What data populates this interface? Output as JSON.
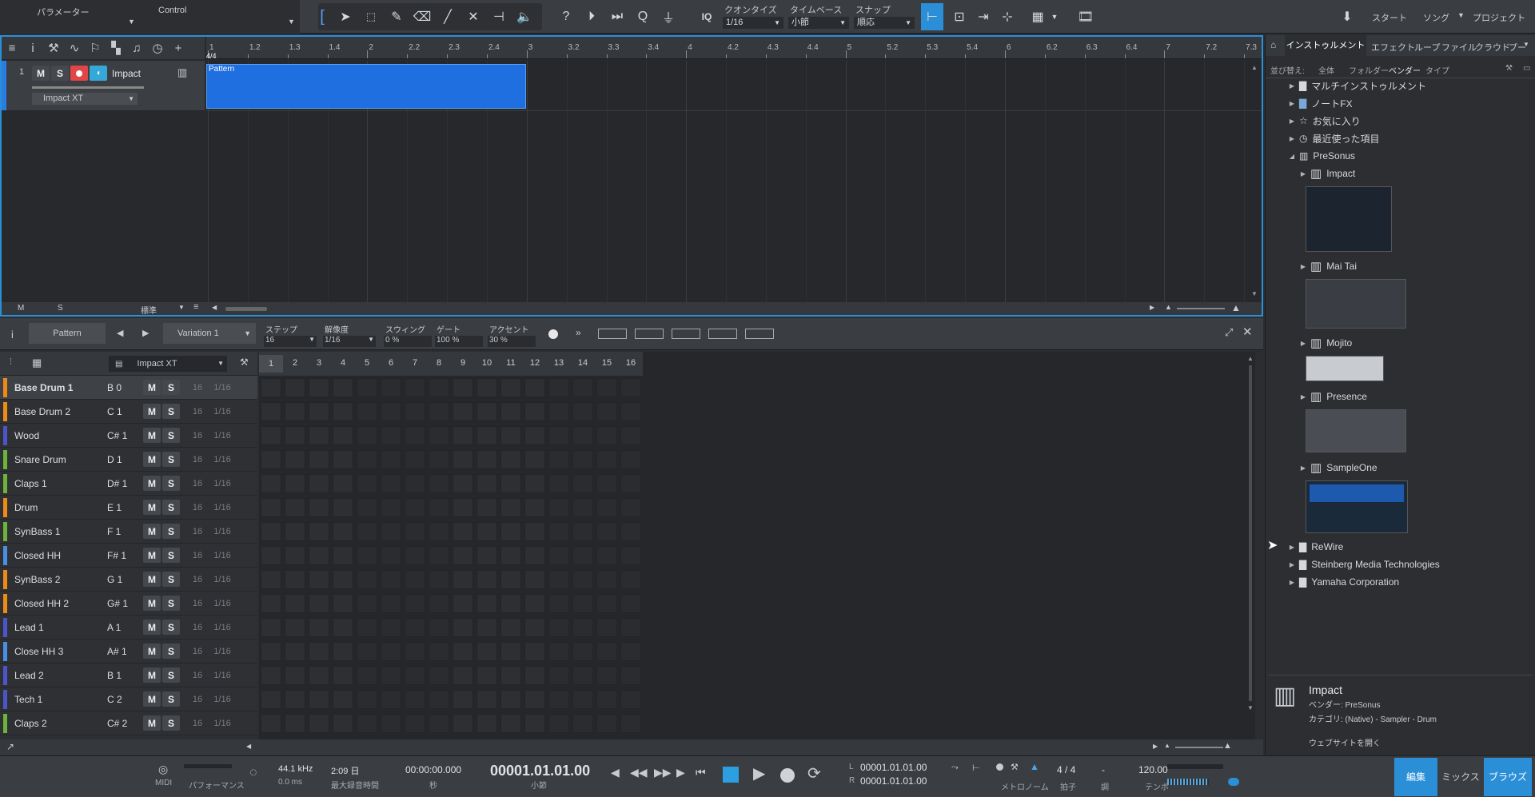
{
  "topbar": {
    "params_label": "パラメーター",
    "control_label": "Control",
    "iq": "IQ",
    "quantize": {
      "label": "クオンタイズ",
      "value": "1/16"
    },
    "timebase": {
      "label": "タイムベース",
      "value": "小節"
    },
    "snap": {
      "label": "スナップ",
      "value": "順応"
    },
    "nav": [
      "スタート",
      "ソング",
      "プロジェクト"
    ]
  },
  "arrange": {
    "ruler_marks": [
      "1",
      "1.2",
      "1.3",
      "1.4",
      "2",
      "2.2",
      "2.3",
      "2.4",
      "3",
      "3.2",
      "3.3",
      "3.4",
      "4",
      "4.2",
      "4.3",
      "4.4",
      "5",
      "5.2",
      "5.3",
      "5.4",
      "6",
      "6.2",
      "6.3",
      "6.4",
      "7",
      "7.2",
      "7.3"
    ],
    "timesig": "4/4",
    "track": {
      "number": "1",
      "m": "M",
      "s": "S",
      "name": "Impact",
      "instrument": "Impact XT"
    },
    "clip_label": "Pattern",
    "bottom": {
      "m": "M",
      "s": "S",
      "mode": "標準"
    }
  },
  "pattern_editor": {
    "pattern_label": "Pattern",
    "variation": "Variation 1",
    "step": {
      "label": "ステップ",
      "value": "16"
    },
    "resolution": {
      "label": "解像度",
      "value": "1/16"
    },
    "swing": {
      "label": "スウィング",
      "value": "0 %"
    },
    "gate": {
      "label": "ゲート",
      "value": "100 %"
    },
    "accent": {
      "label": "アクセント",
      "value": "30 %"
    },
    "instrument_select": "Impact XT",
    "step_numbers": [
      "1",
      "2",
      "3",
      "4",
      "5",
      "6",
      "7",
      "8",
      "9",
      "10",
      "11",
      "12",
      "13",
      "14",
      "15",
      "16"
    ],
    "rows": [
      {
        "name": "Base Drum 1",
        "note": "B 0",
        "color": "#f08a16",
        "steps": "16",
        "res": "1/16"
      },
      {
        "name": "Base Drum 2",
        "note": "C 1",
        "color": "#f08a16",
        "steps": "16",
        "res": "1/16"
      },
      {
        "name": "Wood",
        "note": "C# 1",
        "color": "#4a56c8",
        "steps": "16",
        "res": "1/16"
      },
      {
        "name": "Snare Drum",
        "note": "D 1",
        "color": "#6ab43a",
        "steps": "16",
        "res": "1/16"
      },
      {
        "name": "Claps 1",
        "note": "D# 1",
        "color": "#6ab43a",
        "steps": "16",
        "res": "1/16"
      },
      {
        "name": "Drum",
        "note": "E 1",
        "color": "#f08a16",
        "steps": "16",
        "res": "1/16"
      },
      {
        "name": "SynBass 1",
        "note": "F 1",
        "color": "#6ab43a",
        "steps": "16",
        "res": "1/16"
      },
      {
        "name": "Closed HH",
        "note": "F# 1",
        "color": "#4a90e2",
        "steps": "16",
        "res": "1/16"
      },
      {
        "name": "SynBass 2",
        "note": "G 1",
        "color": "#f08a16",
        "steps": "16",
        "res": "1/16"
      },
      {
        "name": "Closed HH 2",
        "note": "G# 1",
        "color": "#f08a16",
        "steps": "16",
        "res": "1/16"
      },
      {
        "name": "Lead 1",
        "note": "A 1",
        "color": "#4a56c8",
        "steps": "16",
        "res": "1/16"
      },
      {
        "name": "Close HH 3",
        "note": "A# 1",
        "color": "#4a90e2",
        "steps": "16",
        "res": "1/16"
      },
      {
        "name": "Lead 2",
        "note": "B 1",
        "color": "#4a56c8",
        "steps": "16",
        "res": "1/16"
      },
      {
        "name": "Tech 1",
        "note": "C 2",
        "color": "#4a56c8",
        "steps": "16",
        "res": "1/16"
      },
      {
        "name": "Claps 2",
        "note": "C# 2",
        "color": "#6ab43a",
        "steps": "16",
        "res": "1/16"
      }
    ]
  },
  "browser": {
    "tabs": [
      "インストゥルメント",
      "エフェクト",
      "ループ",
      "ファイル",
      "クラウド",
      "プー"
    ],
    "sort_label": "並び替え:",
    "sort_opts": [
      "全体",
      "フォルダー",
      "ベンダー",
      "タイプ"
    ],
    "items": [
      "マルチインストゥルメント",
      "ノートFX",
      "お気に入り",
      "最近使った項目",
      "PreSonus",
      "Impact",
      "Mai Tai",
      "Mojito",
      "Presence",
      "SampleOne",
      "ReWire",
      "Steinberg Media Technologies",
      "Yamaha Corporation"
    ],
    "info": {
      "name": "Impact",
      "vendor": "ベンダー: PreSonus",
      "category": "カテゴリ: (Native) - Sampler - Drum",
      "website": "ウェブサイトを開く"
    }
  },
  "transport": {
    "midi": "MIDI",
    "performance": "パフォーマンス",
    "samplerate": "44.1 kHz",
    "latency": "0.0 ms",
    "rec_time": "2:09 日",
    "rec_time_label": "最大録音時間",
    "seconds": "00:00:00.000",
    "seconds_label": "秒",
    "bars": "00001.01.01.00",
    "bars_label": "小節",
    "loop_l": "00001.01.01.00",
    "loop_r": "00001.01.01.00",
    "l": "L",
    "r": "R",
    "metronome": "メトロノーム",
    "timesig": "4 / 4",
    "timesig_label": "拍子",
    "key": "-",
    "key_label": "調",
    "tempo": "120.00",
    "tempo_label": "テンポ",
    "views": [
      "編集",
      "ミックス",
      "ブラウズ"
    ]
  }
}
